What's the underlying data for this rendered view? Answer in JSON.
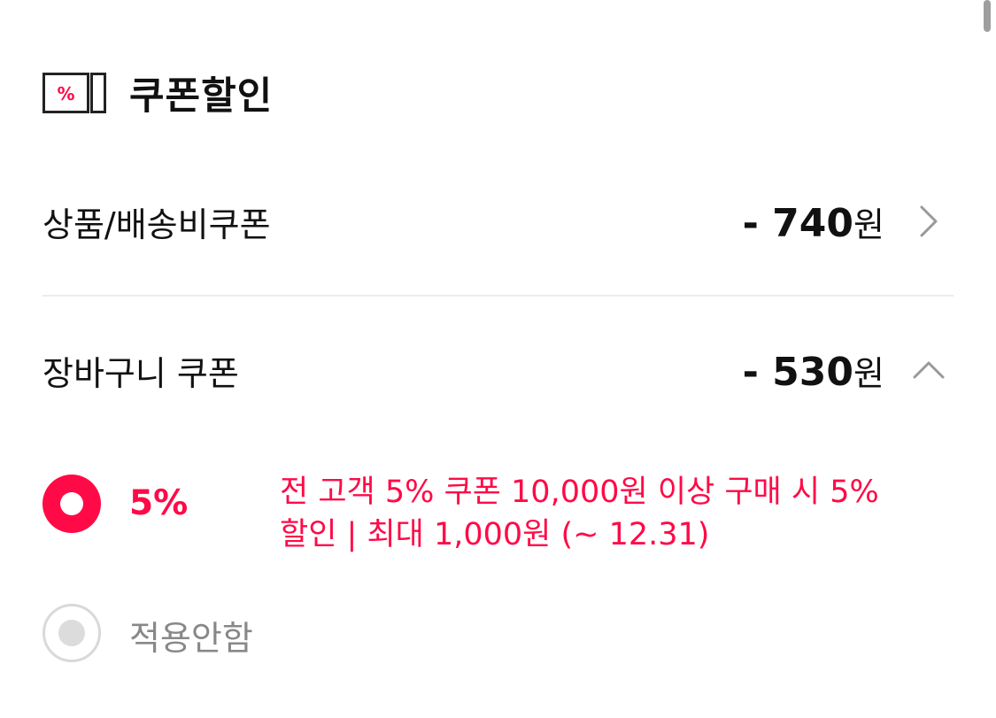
{
  "section": {
    "title": "쿠폰할인",
    "icon": "coupon-ticket-icon",
    "icon_glyph": "%"
  },
  "rows": [
    {
      "label": "상품/배송비쿠폰",
      "amount": "- 740",
      "unit": "원",
      "chevron": "chevron-right-icon"
    },
    {
      "label": "장바구니 쿠폰",
      "amount": "- 530",
      "unit": "원",
      "chevron": "chevron-up-icon"
    }
  ],
  "options": [
    {
      "rate": "5%",
      "description": "전 고객 5% 쿠폰 10,000원 이상 구매 시 5% 할인 | 최대 1,000원 (~ 12.31)",
      "selected": true
    },
    {
      "label": "적용안함",
      "selected": false
    }
  ],
  "colors": {
    "accent": "#ff0a47",
    "text": "#111111",
    "muted": "#888888",
    "divider": "#ececec"
  }
}
